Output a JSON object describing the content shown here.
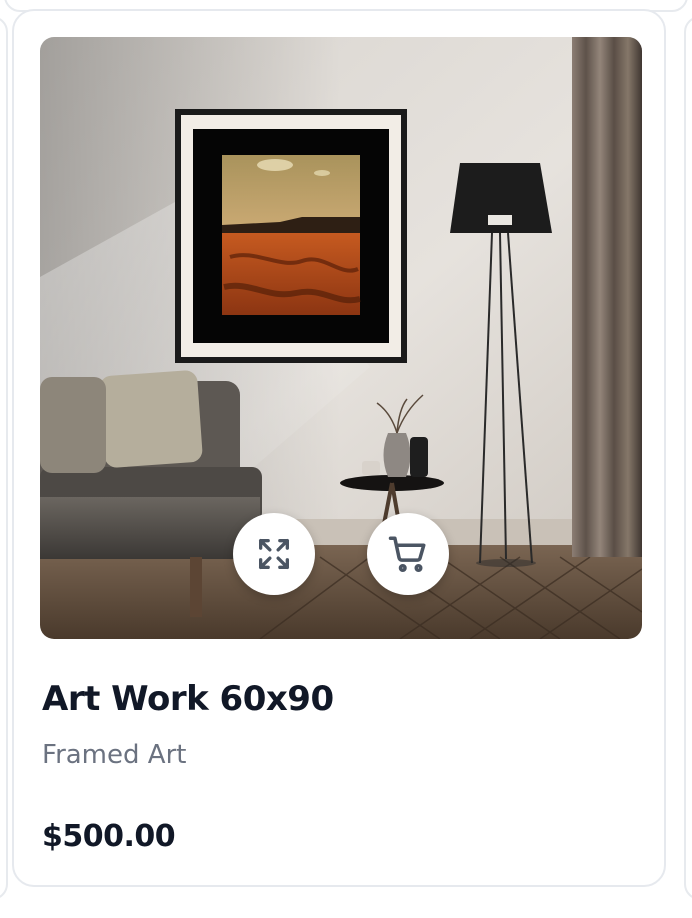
{
  "product": {
    "title": "Art Work 60x90",
    "category": "Framed Art",
    "price": "$500.00",
    "image_description_icon": "framed-desert-landscape-photo"
  },
  "actions": {
    "expand_icon": "expand-icon",
    "cart_icon": "shopping-cart-icon"
  },
  "colors": {
    "text_primary": "#111827",
    "text_secondary": "#6b7280",
    "icon_color": "#4b5563",
    "card_border": "#e6e9ee"
  }
}
